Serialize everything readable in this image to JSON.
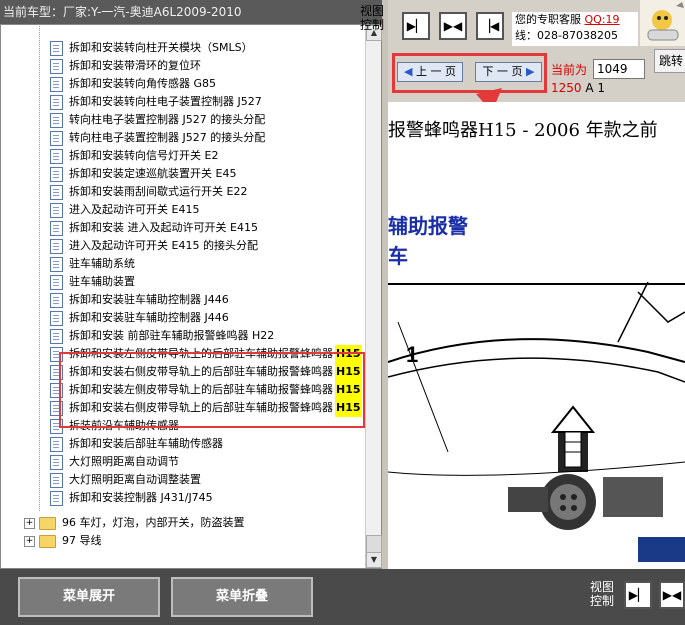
{
  "header": {
    "car_model_label": "当前车型：厂家:Y-一汽-奥迪A6L2009-2010",
    "view_control": [
      "视图",
      "控制"
    ],
    "service_line1": "您的专职客服",
    "service_qq": "QQ:19",
    "service_line2": "线：028-87038205"
  },
  "tree": {
    "items": [
      {
        "label": "拆卸和安装转向柱开关模块（SMLS）",
        "tag": ""
      },
      {
        "label": "拆卸和安装带滑环的复位环",
        "tag": ""
      },
      {
        "label": "拆卸和安装转向角传感器 G85",
        "tag": ""
      },
      {
        "label": "拆卸和安装转向柱电子装置控制器 J527",
        "tag": ""
      },
      {
        "label": "转向柱电子装置控制器 J527 的接头分配",
        "tag": ""
      },
      {
        "label": "转向柱电子装置控制器 J527 的接头分配",
        "tag": ""
      },
      {
        "label": "拆卸和安装转向信号灯开关 E2",
        "tag": ""
      },
      {
        "label": "拆卸和安装定速巡航装置开关 E45",
        "tag": ""
      },
      {
        "label": "拆卸和安装雨刮间歇式运行开关 E22",
        "tag": ""
      },
      {
        "label": "进入及起动许可开关 E415",
        "tag": ""
      },
      {
        "label": "拆卸和安装 进入及起动许可开关 E415",
        "tag": ""
      },
      {
        "label": "进入及起动许可开关 E415 的接头分配",
        "tag": ""
      },
      {
        "label": "驻车辅助系统",
        "tag": ""
      },
      {
        "label": "驻车辅助装置",
        "tag": ""
      },
      {
        "label": "拆卸和安装驻车辅助控制器 J446",
        "tag": ""
      },
      {
        "label": "拆卸和安装驻车辅助控制器 J446",
        "tag": ""
      },
      {
        "label": "拆卸和安装 前部驻车辅助报警蜂鸣器 H22",
        "tag": ""
      },
      {
        "label": "拆卸和安装左侧皮带导轨上的后部驻车辅助报警蜂鸣器",
        "tag": "H15"
      },
      {
        "label": "拆卸和安装右侧皮带导轨上的后部驻车辅助报警蜂鸣器",
        "tag": "H15"
      },
      {
        "label": "拆卸和安装左侧皮带导轨上的后部驻车辅助报警蜂鸣器",
        "tag": "H15"
      },
      {
        "label": "拆卸和安装右侧皮带导轨上的后部驻车辅助报警蜂鸣器",
        "tag": "H15"
      },
      {
        "label": "拆装前沿车辅助传感器",
        "tag": ""
      },
      {
        "label": "拆卸和安装后部驻车辅助传感器",
        "tag": ""
      },
      {
        "label": "大灯照明距离自动调节",
        "tag": ""
      },
      {
        "label": "大灯照明距离自动调整装置",
        "tag": ""
      },
      {
        "label": "拆卸和安装控制器 J431/J745",
        "tag": ""
      }
    ],
    "folders": [
      "96 车灯，灯泡，内部开关，防盗装置",
      "97 导线"
    ]
  },
  "pager": {
    "prev_label": "上 一 页",
    "next_label": "下 一 页",
    "current_label": "当前为",
    "current_page": "1049",
    "jump_label": "跳转",
    "total": "1250",
    "suffix": "A 1"
  },
  "content": {
    "heading": "报警蜂鸣器H15 - 2006 年款之前",
    "sub1": "辅助报警",
    "sub2": "车",
    "diagram_label": "1"
  },
  "bottom": {
    "expand_label": "菜单展开",
    "collapse_label": "菜单折叠",
    "view_control": [
      "视图",
      "控制"
    ]
  },
  "colors": {
    "highlight_border": "#e23a3a",
    "tag_bg": "#ffff00",
    "heading_blue": "#1a2ea8"
  }
}
